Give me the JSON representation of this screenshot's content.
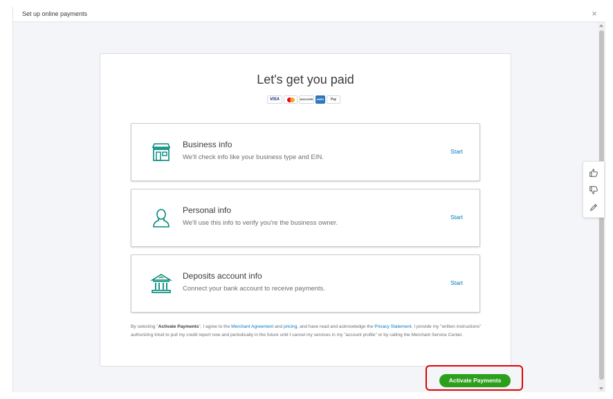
{
  "window": {
    "title": "Set up online payments",
    "close_glyph": "×"
  },
  "main": {
    "heading": "Let's get you paid",
    "logos": {
      "visa": "VISA",
      "discover": "DISCOVER",
      "amex": "AMEX",
      "applepay": " Pay"
    },
    "steps": [
      {
        "title": "Business info",
        "desc": "We'll check info like your business type and EIN.",
        "link": "Start",
        "icon": "storefront-icon"
      },
      {
        "title": "Personal info",
        "desc": "We'll use this info to verify you're the business owner.",
        "link": "Start",
        "icon": "person-icon"
      },
      {
        "title": "Deposits account info",
        "desc": "Connect your bank account to receive payments.",
        "link": "Start",
        "icon": "bank-icon"
      }
    ],
    "legal": {
      "p1": "By selecting \"",
      "activate": "Activate Payments",
      "p2": "\", I agree to the ",
      "merchant": "Merchant Agreement",
      "p3": " and ",
      "pricing": "pricing",
      "p4": ", and have read and acknowledge the ",
      "privacy": "Privacy Statement",
      "p5": ". I provide my \"written instructions\" authorizing Intuit to pull my credit report now and periodically in the future until I cancel my services in my \"account profile\" or by calling the Merchant Service Center."
    },
    "activate_button": "Activate Payments"
  },
  "feedback": {
    "icons": [
      "thumbs-up-icon",
      "thumbs-down-icon",
      "pencil-icon"
    ]
  },
  "colors": {
    "accent_green": "#2ca01c",
    "link_blue": "#0077c5",
    "icon_teal": "#00897b",
    "highlight_red": "#e00000"
  }
}
